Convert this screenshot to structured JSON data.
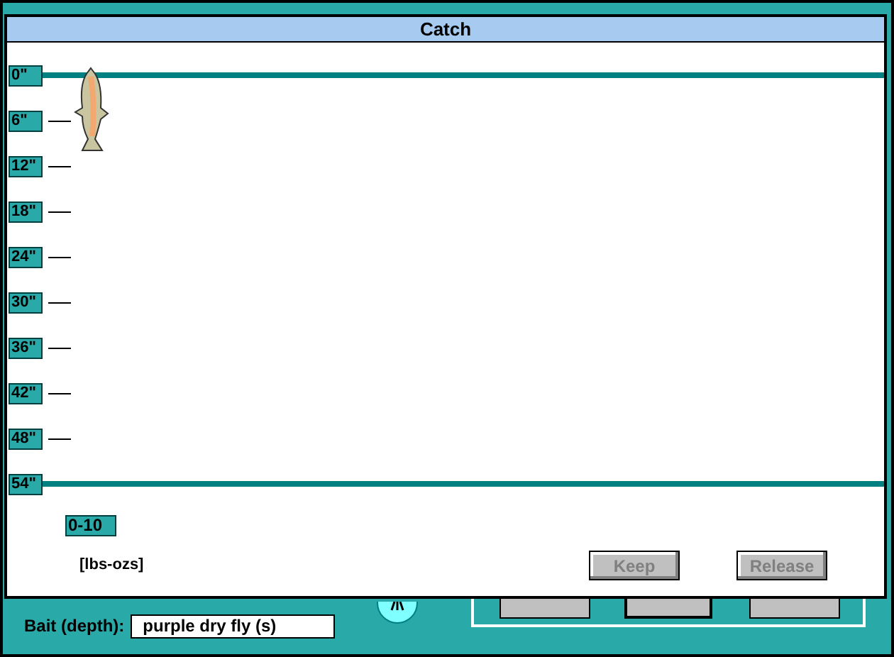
{
  "dialog": {
    "title": "Catch"
  },
  "ruler": [
    {
      "label": "0\"",
      "kind": "boundary"
    },
    {
      "label": "6\"",
      "kind": "tick"
    },
    {
      "label": "12\"",
      "kind": "tick"
    },
    {
      "label": "18\"",
      "kind": "tick"
    },
    {
      "label": "24\"",
      "kind": "tick"
    },
    {
      "label": "30\"",
      "kind": "tick"
    },
    {
      "label": "36\"",
      "kind": "tick"
    },
    {
      "label": "42\"",
      "kind": "tick"
    },
    {
      "label": "48\"",
      "kind": "tick"
    },
    {
      "label": "54\"",
      "kind": "boundary"
    }
  ],
  "weight_scale": "0-10",
  "weight_units": "[lbs-ozs]",
  "buttons": [
    {
      "label": "Keep",
      "disabled": true
    },
    {
      "label": "Release",
      "disabled": true
    }
  ],
  "bait": {
    "label": "Bait (depth):",
    "value": "purple dry fly (s)"
  }
}
